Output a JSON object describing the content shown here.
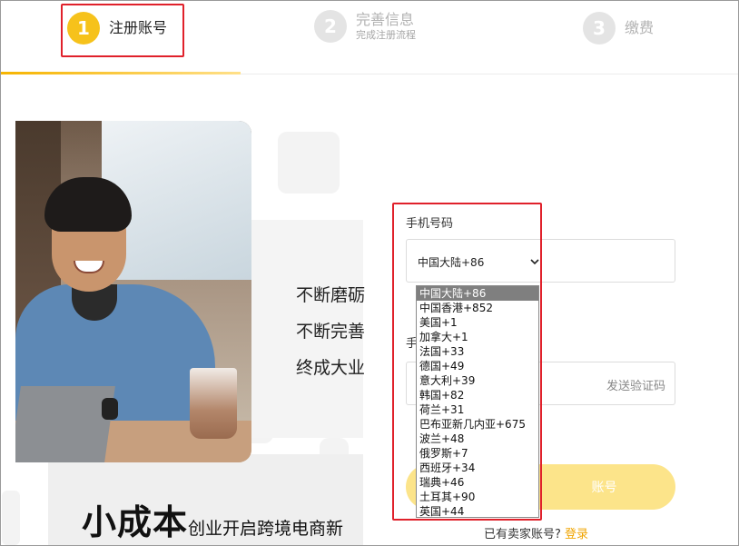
{
  "steps": [
    {
      "number": "1",
      "title": "注册账号",
      "subtitle": ""
    },
    {
      "number": "2",
      "title": "完善信息",
      "subtitle": "完成注册流程"
    },
    {
      "number": "3",
      "title": "缴费",
      "subtitle": ""
    }
  ],
  "active_step": 1,
  "slogan": {
    "line1": "不断磨砺",
    "line2": "不断完善",
    "line3": "终成大业",
    "big": "小成本",
    "small": "创业开启跨境电商新"
  },
  "form": {
    "phone_label": "手机号码",
    "selected_country": "中国大陆+86",
    "code_label": "手",
    "send_code": "发送验证码",
    "register_label": "账号",
    "has_account": "已有卖家账号?",
    "login": "登录"
  },
  "country_options": [
    "中国大陆+86",
    "中国香港+852",
    "美国+1",
    "加拿大+1",
    "法国+33",
    "德国+49",
    "意大利+39",
    "韩国+82",
    "荷兰+31",
    "巴布亚新几内亚+675",
    "波兰+48",
    "俄罗斯+7",
    "西班牙+34",
    "瑞典+46",
    "土耳其+90",
    "英国+44"
  ],
  "colors": {
    "accent": "#f6c21b",
    "highlight": "#e0212b",
    "button": "#fce48a",
    "link": "#f0a400"
  }
}
